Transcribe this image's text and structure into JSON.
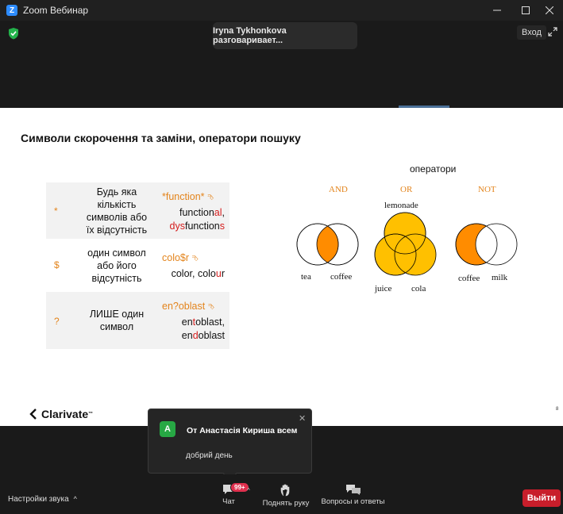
{
  "window": {
    "app_icon_letter": "Z",
    "title": "Zoom Вебинар"
  },
  "top": {
    "speaker_text": "Iryna Tykhonkova разговаривает...",
    "exit_fullscreen_label": "Вход"
  },
  "slide": {
    "title": "Символи скорочення та заміни, оператори пошуку",
    "rows": [
      {
        "symbol": "*",
        "description_lines": [
          "Будь яка",
          "кількість",
          "символів або",
          "їх відсутність"
        ],
        "example": "*function*",
        "results": [
          [
            {
              "t": "function",
              "red": false
            },
            {
              "t": "al",
              "red": true
            },
            {
              "t": ",",
              "red": false
            }
          ],
          [
            {
              "t": "dys",
              "red": true
            },
            {
              "t": "function",
              "red": false
            },
            {
              "t": "s",
              "red": true
            }
          ]
        ]
      },
      {
        "symbol": "$",
        "description_lines": [
          "один символ",
          "або його",
          "відсутність"
        ],
        "example": "colo$r",
        "results": [
          [
            {
              "t": "color, colo",
              "red": false
            },
            {
              "t": "u",
              "red": true
            },
            {
              "t": "r",
              "red": false
            }
          ]
        ]
      },
      {
        "symbol": "?",
        "description_lines": [
          "ЛИШЕ один",
          "символ"
        ],
        "example": "en?oblast",
        "results": [
          [
            {
              "t": "en",
              "red": false
            },
            {
              "t": "t",
              "red": true
            },
            {
              "t": "oblast,",
              "red": false
            }
          ],
          [
            {
              "t": "en",
              "red": false
            },
            {
              "t": "d",
              "red": true
            },
            {
              "t": "oblast",
              "red": false
            }
          ]
        ]
      }
    ],
    "operators_label": "оператори",
    "venn": {
      "and": {
        "label": "AND",
        "left": "tea",
        "right": "coffee"
      },
      "or": {
        "label": "OR",
        "top": "lemonade",
        "left": "juice",
        "right": "cola"
      },
      "not": {
        "label": "NOT",
        "left": "coffee",
        "right": "milk"
      }
    },
    "logo_text": "Clarivate",
    "logo_tm": "™",
    "page_mark": "8"
  },
  "chat": {
    "avatar_letter": "A",
    "sender": "От Анастасія Кириша всем",
    "message": "добрий день"
  },
  "toolbar": {
    "audio_settings": "Настройки звука",
    "chat": "Чат",
    "chat_badge": "99+",
    "raise_hand": "Поднять руку",
    "qa": "Вопросы и ответы",
    "leave": "Выйти"
  },
  "colors": {
    "accent_orange": "#e3841c",
    "venn_fill": "#ff8c00",
    "venn_or_fill": "#ffc000",
    "leave_red": "#c81e2b",
    "badge_red": "#e0304e",
    "avatar_green": "#27a844"
  },
  "icons": [
    "shield-check-icon",
    "fullscreen-icon",
    "chat-icon",
    "raise-hand-icon",
    "qa-icon",
    "close-icon",
    "chevron-up-icon"
  ]
}
